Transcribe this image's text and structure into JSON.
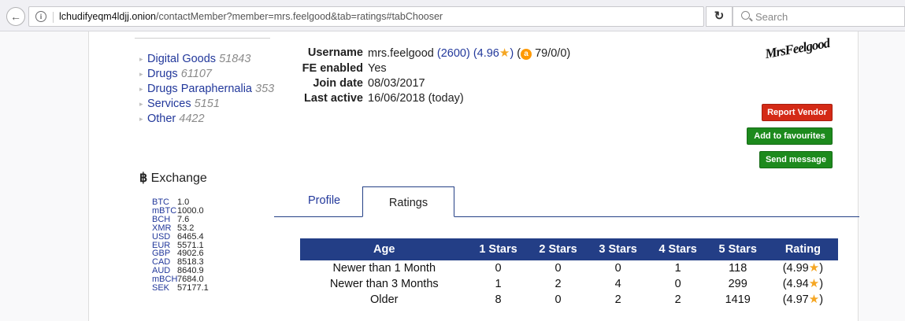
{
  "browser": {
    "url_host": "lchudifyeqm4ldjj.onion",
    "url_path": "/contactMember?member=mrs.feelgood&tab=ratings#tabChooser",
    "search_placeholder": "Search",
    "back_glyph": "←",
    "reload_glyph": "↻",
    "info_glyph": "i"
  },
  "sidebar": {
    "categories": [
      {
        "name": "Digital Goods",
        "count": "51843"
      },
      {
        "name": "Drugs",
        "count": "61107"
      },
      {
        "name": "Drugs Paraphernalia",
        "count": "353"
      },
      {
        "name": "Services",
        "count": "5151"
      },
      {
        "name": "Other",
        "count": "4422"
      }
    ],
    "exchange_symbol": "฿",
    "exchange_title": "Exchange",
    "rates": [
      {
        "cur": "BTC",
        "val": "1.0"
      },
      {
        "cur": "mBTC",
        "val": "1000.0"
      },
      {
        "cur": "BCH",
        "val": "7.6"
      },
      {
        "cur": "XMR",
        "val": "53.2"
      },
      {
        "cur": "USD",
        "val": "6465.4"
      },
      {
        "cur": "EUR",
        "val": "5571.1"
      },
      {
        "cur": "GBP",
        "val": "4902.6"
      },
      {
        "cur": "CAD",
        "val": "8518.3"
      },
      {
        "cur": "AUD",
        "val": "8640.9"
      },
      {
        "cur": "mBCH",
        "val": "7684.0"
      },
      {
        "cur": "SEK",
        "val": "57177.1"
      }
    ]
  },
  "profile": {
    "username_label": "Username",
    "username": "mrs.feelgood",
    "rating_count": "(2600)",
    "rating_open": "(4.96",
    "rating_close": ")",
    "amazon_open": "(",
    "amazon_glyph": "a",
    "amazon_stats": "79/0/0)",
    "fe_label": "FE enabled",
    "fe_value": "Yes",
    "join_label": "Join date",
    "join_value": "08/03/2017",
    "active_label": "Last active",
    "active_value": "16/06/2018 (today)",
    "signature": "MrsFeelgood",
    "star_color": "#f5a623"
  },
  "actions": {
    "report": "Report Vendor",
    "favourites": "Add to favourites",
    "message": "Send message"
  },
  "tabs": {
    "profile": "Profile",
    "ratings": "Ratings"
  },
  "ratings_table": {
    "headers": [
      "Age",
      "1 Stars",
      "2 Stars",
      "3 Stars",
      "4 Stars",
      "5 Stars",
      "Rating"
    ],
    "rows": [
      {
        "age": "Newer than 1 Month",
        "s1": "0",
        "s2": "0",
        "s3": "0",
        "s4": "1",
        "s5": "118",
        "rating": "(4.99",
        "close": ")"
      },
      {
        "age": "Newer than 3 Months",
        "s1": "1",
        "s2": "2",
        "s3": "4",
        "s4": "0",
        "s5": "299",
        "rating": "(4.94",
        "close": ")"
      },
      {
        "age": "Older",
        "s1": "8",
        "s2": "0",
        "s3": "2",
        "s4": "2",
        "s5": "1419",
        "rating": "(4.97",
        "close": ")"
      }
    ],
    "header_color": "#233e86"
  }
}
